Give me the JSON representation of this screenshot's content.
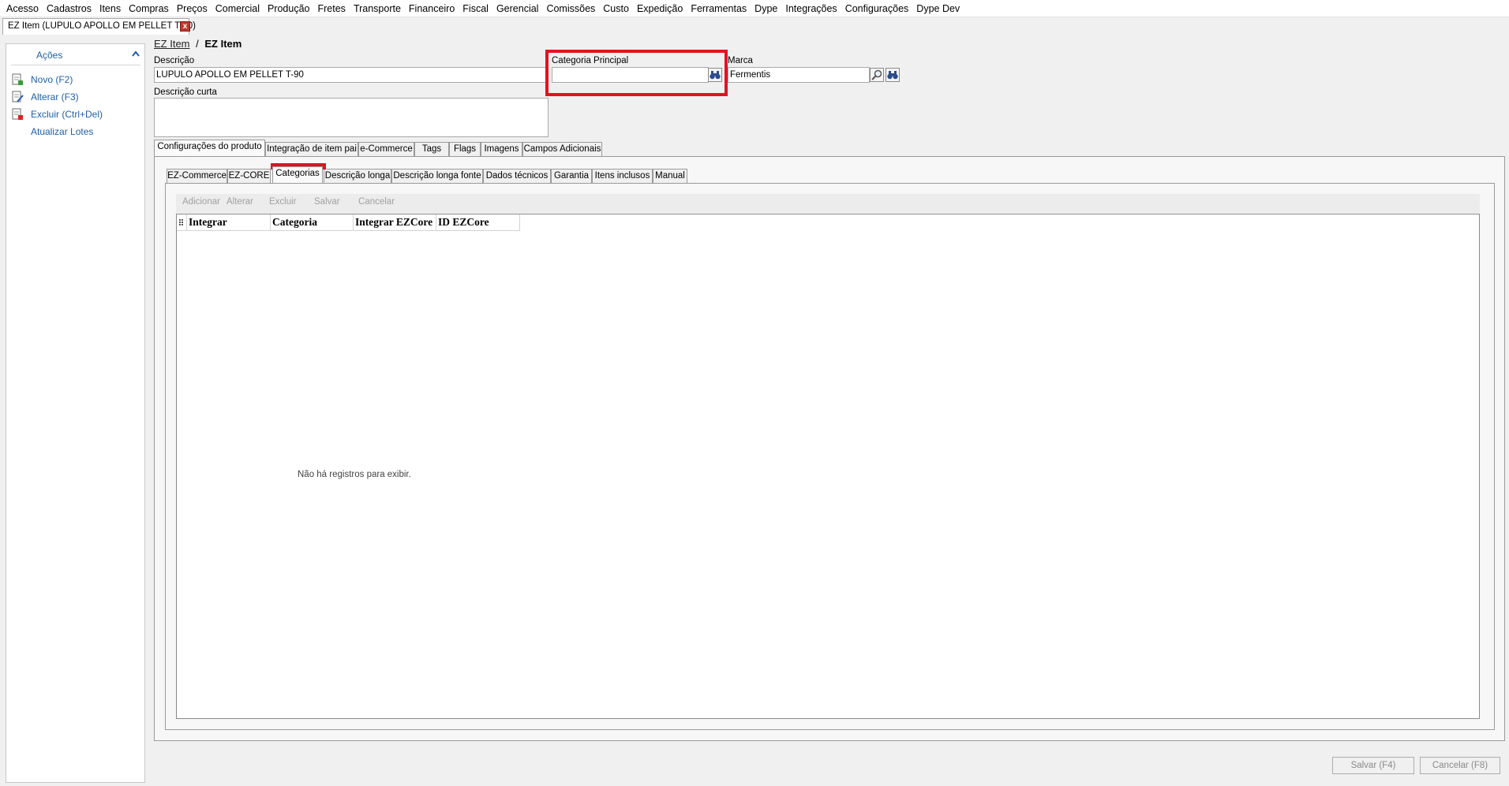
{
  "menu": [
    "Acesso",
    "Cadastros",
    "Itens",
    "Compras",
    "Preços",
    "Comercial",
    "Produção",
    "Fretes",
    "Transporte",
    "Financeiro",
    "Fiscal",
    "Gerencial",
    "Comissões",
    "Custo",
    "Expedição",
    "Ferramentas",
    "Dype",
    "Integrações",
    "Configurações",
    "Dype Dev"
  ],
  "document_tab": {
    "title": "EZ Item (LUPULO APOLLO EM PELLET T-90)",
    "close_glyph": "x"
  },
  "sidebar": {
    "title": "Ações",
    "actions": [
      {
        "label": "Novo (F2)",
        "icon": "new-document-icon"
      },
      {
        "label": "Alterar (F3)",
        "icon": "edit-document-icon"
      },
      {
        "label": "Excluir (Ctrl+Del)",
        "icon": "delete-document-icon"
      },
      {
        "label": "Atualizar Lotes",
        "icon": ""
      }
    ]
  },
  "breadcrumb": {
    "link": "EZ Item",
    "separator": "/",
    "current": "EZ Item"
  },
  "form": {
    "descricao": {
      "label": "Descrição",
      "value": "LUPULO APOLLO EM PELLET T-90"
    },
    "categoria_principal": {
      "label": "Categoria Principal",
      "value": ""
    },
    "marca": {
      "label": "Marca",
      "value": "Fermentis"
    },
    "descricao_curta": {
      "label": "Descrição curta",
      "value": ""
    }
  },
  "main_tabs": [
    "Configurações do produto",
    "Integração de item pai",
    "e-Commerce",
    "Tags",
    "Flags",
    "Imagens",
    "Campos Adicionais"
  ],
  "sub_tabs": [
    "EZ-Commerce",
    "EZ-CORE",
    "Categorias",
    "Descrição longa",
    "Descrição longa fonte",
    "Dados técnicos",
    "Garantia",
    "Itens inclusos",
    "Manual"
  ],
  "grid_toolbar": [
    "Adicionar",
    "Alterar",
    "Excluir",
    "Salvar",
    "Cancelar"
  ],
  "grid": {
    "columns": [
      "Integrar",
      "Categoria",
      "Integrar EZCore",
      "ID EZCore"
    ],
    "empty_message": "Não há registros para exibir."
  },
  "footer": {
    "save": "Salvar (F4)",
    "cancel": "Cancelar (F8)"
  },
  "colors": {
    "highlight": "#e0141e",
    "link": "#1f5fa8"
  }
}
